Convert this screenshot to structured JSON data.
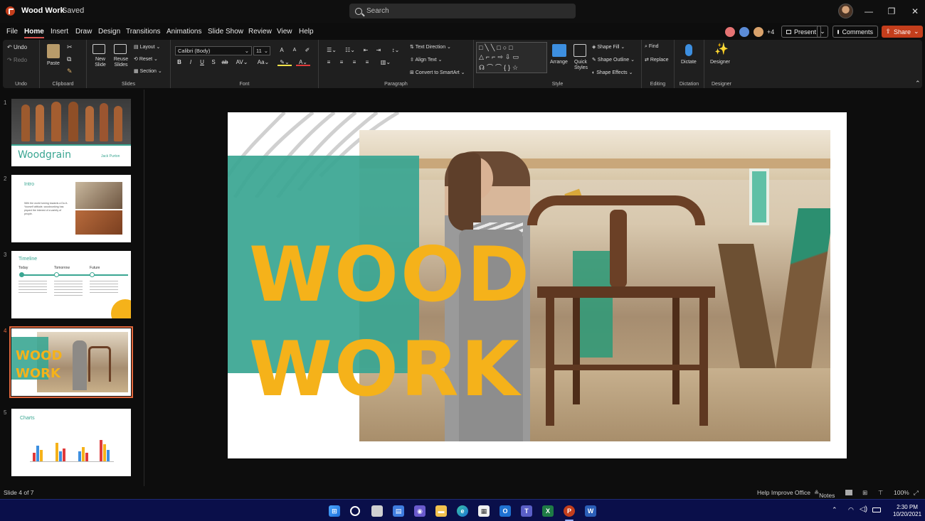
{
  "title_bar": {
    "doc_title": "Wood Work",
    "doc_status": "Saved",
    "search_placeholder": "Search",
    "minimize": "—",
    "restore": "❐",
    "close": "✕"
  },
  "menu": {
    "items": [
      "File",
      "Home",
      "Insert",
      "Draw",
      "Design",
      "Transitions",
      "Animations",
      "Slide Show",
      "Review",
      "View",
      "Help"
    ],
    "active": "Home"
  },
  "collab": {
    "extra_count": "+4",
    "present_label": "Present",
    "comments_label": "Comments",
    "share_label": "Share"
  },
  "ribbon": {
    "undo": "Undo",
    "redo": "Redo",
    "paste": "Paste",
    "new_slide": "New Slide",
    "reuse_slides": "Reuse Slides",
    "layout": "Layout",
    "reset": "Reset",
    "section": "Section",
    "font_name": "Calibri (Body)",
    "font_size": "11",
    "text_direction": "Text Direction",
    "align_text": "Align Text",
    "convert_smartart": "Convert to SmartArt",
    "arrange": "Arrange",
    "quick_styles": "Quick Styles",
    "shape_fill": "Shape Fill",
    "shape_outline": "Shape Outline",
    "shape_effects": "Shape Effects",
    "find": "Find",
    "replace": "Replace",
    "dictate": "Dictate",
    "designer": "Designer",
    "groups": [
      "Undo",
      "Clipboard",
      "Slides",
      "Font",
      "Paragraph",
      "Style",
      "Editing",
      "Dictation",
      "Designer"
    ]
  },
  "thumbnails": [
    {
      "num": "1",
      "title": "Woodgrain",
      "author": "Jack Purton"
    },
    {
      "num": "2",
      "title": "Intro",
      "body": "With the world turning towards a Do-It-Yourself attitude, woodworking has piqued the interest of a variety of people."
    },
    {
      "num": "3",
      "title": "Timeline",
      "labels": [
        "Today",
        "Tomorrow",
        "Future"
      ]
    },
    {
      "num": "4",
      "title_line1": "WOOD",
      "title_line2": "WORK"
    },
    {
      "num": "5",
      "title": "Charts"
    }
  ],
  "slide": {
    "line1": "WOOD",
    "line2": "WORK"
  },
  "status": {
    "slide_counter": "Slide 4 of 7",
    "help_improve": "Help Improve Office",
    "notes": "Notes",
    "zoom": "100%"
  },
  "taskbar": {
    "time": "2:30 PM",
    "date": "10/20/2021"
  },
  "colors": {
    "teal": "#3aa692",
    "gold": "#f5b21a",
    "brand_red": "#c43e1c",
    "selection": "#e2673c"
  }
}
